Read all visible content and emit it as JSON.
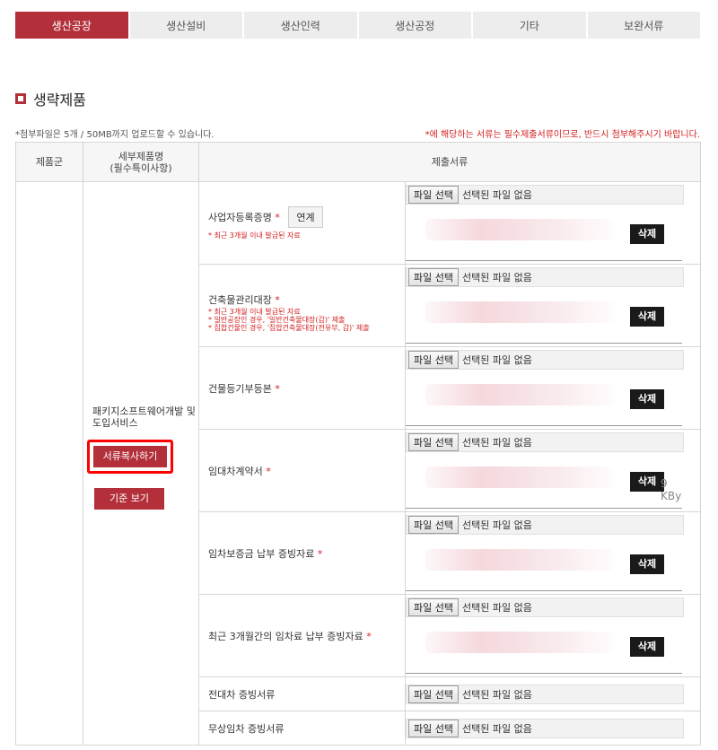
{
  "tabs": [
    {
      "label": "생산공장",
      "active": true
    },
    {
      "label": "생산설비",
      "active": false
    },
    {
      "label": "생산인력",
      "active": false
    },
    {
      "label": "생산공정",
      "active": false
    },
    {
      "label": "기타",
      "active": false
    },
    {
      "label": "보완서류",
      "active": false
    }
  ],
  "section": {
    "title": "생략제품"
  },
  "notes": {
    "left": "*첨부파일은 5개 / 50MB까지 업로드할 수 있습니다.",
    "right": "*에 해당하는 서류는 필수제출서류이므로, 반드시 첨부해주시기 바랍니다."
  },
  "table": {
    "headers": {
      "category": "제품군",
      "detail_line1": "세부제품명",
      "detail_line2": "(필수특이사항)",
      "documents": "제출서류"
    },
    "detail_name": "패키지소프트웨어개발 및도입서비스",
    "copy_button": "서류복사하기",
    "standard_button": "기준 보기",
    "file_select": "파일 선택",
    "no_file": "선택된 파일 없음",
    "delete": "삭제",
    "required_mark": "*",
    "size_fragment": "9 KBy",
    "docs": [
      {
        "name": "사업자등록증명",
        "link": "연계",
        "notes": [
          "* 최근 3개월 이내 발급된 자료"
        ]
      },
      {
        "name": "건축물관리대장",
        "notes": [
          "* 최근 3개월 이내 발급된 자료",
          "* 일반공장인 경우, '일반건축물대장(갑)' 제출",
          "* 집합건물인 경우, '집합건축물대장(전유부, 갑)' 제출"
        ]
      },
      {
        "name": "건물등기부등본",
        "notes": []
      },
      {
        "name": "임대차계약서",
        "notes": []
      },
      {
        "name": "임차보증금 납부 증빙자료",
        "notes": []
      },
      {
        "name": "최근 3개월간의 임차료 납부 증빙자료",
        "notes": []
      },
      {
        "name": "전대차 증빙서류"
      },
      {
        "name": "무상임차 증빙서류"
      }
    ]
  }
}
